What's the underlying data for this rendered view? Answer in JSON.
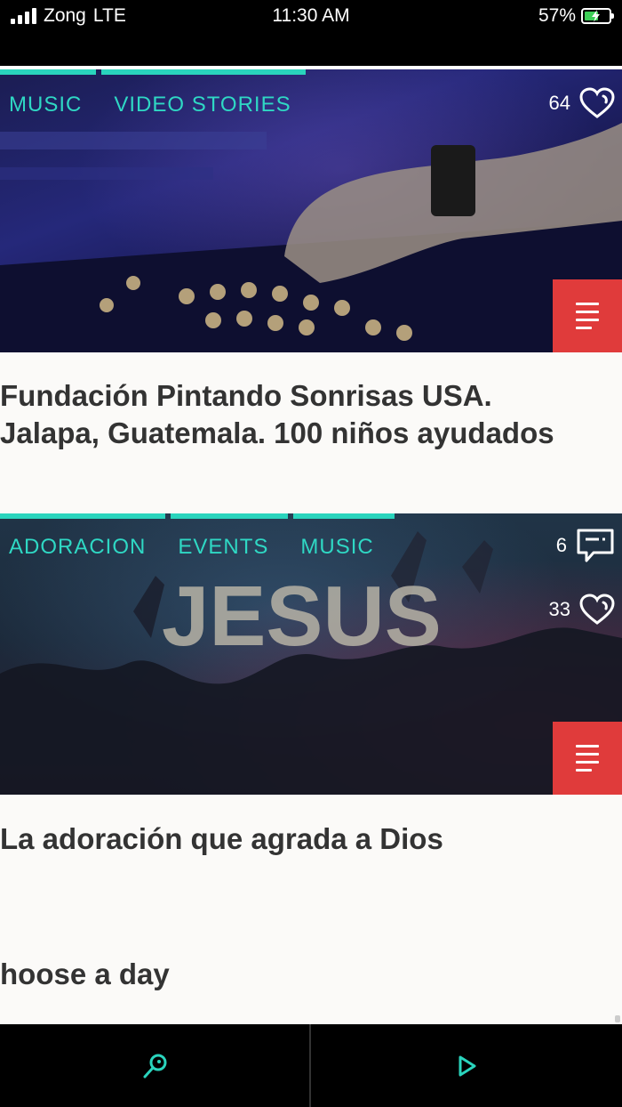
{
  "status_bar": {
    "carrier": "Zong",
    "network": "LTE",
    "time": "11:30 AM",
    "battery_percent": "57%",
    "battery_level": 0.57,
    "signal_icon": "signal-bars-icon",
    "battery_icon": "battery-charging-icon"
  },
  "cards": [
    {
      "tags": [
        "MUSIC",
        "VIDEO STORIES"
      ],
      "likes": "64",
      "title_lines": [
        "Fundación Pintando Sonrisas USA.",
        "Jalapa, Guatemala. 100 niños ayudados"
      ],
      "image_subject": "dj-mixer-photo"
    },
    {
      "tags": [
        "ADORACION",
        "EVENTS",
        "MUSIC"
      ],
      "comments": "6",
      "likes": "33",
      "title_lines": [
        "La adoración que agrada a Dios"
      ],
      "image_text": "JESUS"
    }
  ],
  "section_title": "hoose a day",
  "colors": {
    "accent": "#2ad4bd",
    "menu_button": "#e03b3b",
    "text_dark": "#333333"
  },
  "bottom_nav": {
    "left_icon": "search-icon",
    "right_icon": "play-icon"
  }
}
